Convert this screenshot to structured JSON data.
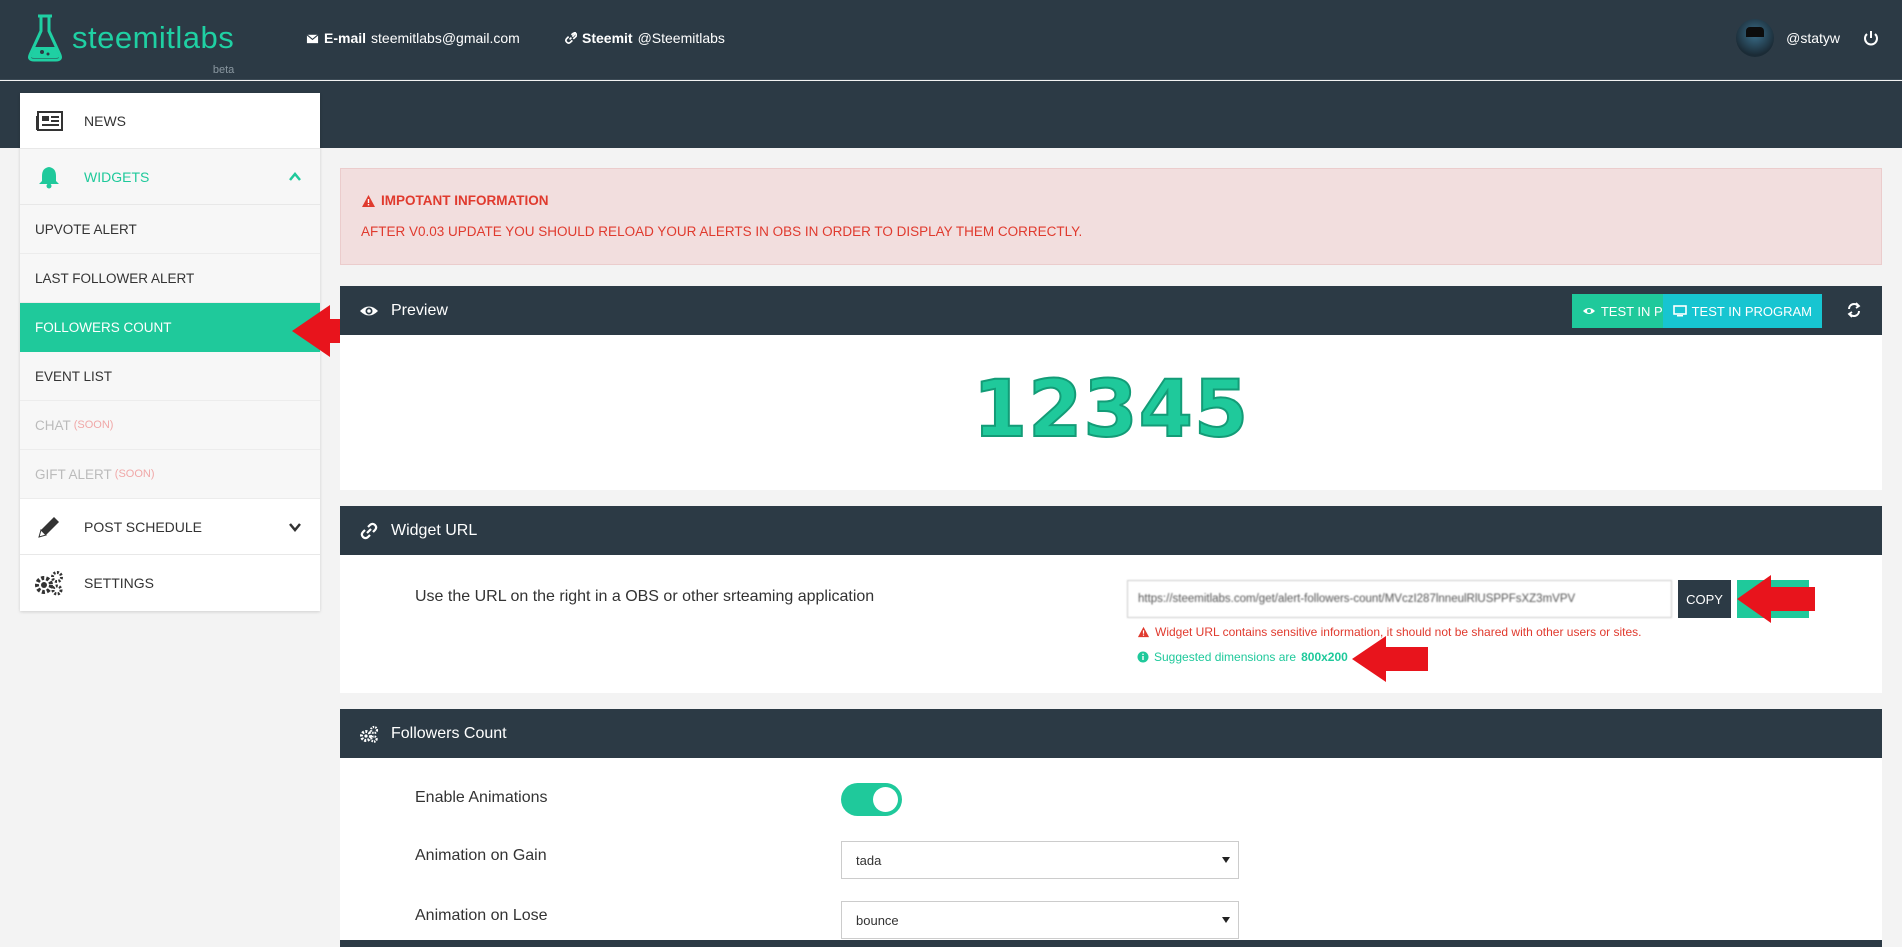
{
  "brand": {
    "name": "steemitlabs",
    "tag": "beta"
  },
  "header": {
    "email_label": "E-mail",
    "email_value": "steemitlabs@gmail.com",
    "steemit_label": "Steemit",
    "steemit_value": "@Steemitlabs",
    "username": "@statyw"
  },
  "sidebar": {
    "news": "NEWS",
    "widgets": "WIDGETS",
    "widget_items": {
      "upvote": "UPVOTE ALERT",
      "last_follower": "LAST FOLLOWER ALERT",
      "followers_count": "FOLLOWERS COUNT",
      "event_list": "EVENT LIST",
      "chat": "CHAT",
      "gift": "GIFT ALERT",
      "soon": "(SOON)"
    },
    "post_schedule": "POST SCHEDULE",
    "settings": "SETTINGS"
  },
  "alert": {
    "title": "IMPOTANT INFORMATION",
    "text": "AFTER V0.03 UPDATE YOU SHOULD RELOAD YOUR ALERTS IN OBS IN ORDER TO DISPLAY THEM CORRECTLY."
  },
  "preview": {
    "title": "Preview",
    "test_preview": "TEST IN PREVIEW",
    "test_program": "TEST IN PROGRAM",
    "number": "12345"
  },
  "widget_url": {
    "title": "Widget URL",
    "label": "Use the URL on the right in a OBS or other srteaming application",
    "url": "https://steemitlabs.com/get/alert-followers-count/MVczI287lnneulRlUSPPFsXZ3mVPV",
    "copy": "COPY",
    "warning": "Widget URL contains sensitive information, it should not be shared with other users or sites.",
    "info_prefix": "Suggested dimensions are",
    "info_dims": "800x200"
  },
  "followers_count": {
    "title": "Followers Count",
    "enable_animations": "Enable Animations",
    "animation_gain": "Animation on Gain",
    "animation_gain_value": "tada",
    "animation_lose": "Animation on Lose",
    "animation_lose_value": "bounce"
  },
  "colors": {
    "accent": "#1fc99b",
    "dark": "#2c3a45",
    "alert": "#e03a2e",
    "cyan": "#17c5d1"
  }
}
